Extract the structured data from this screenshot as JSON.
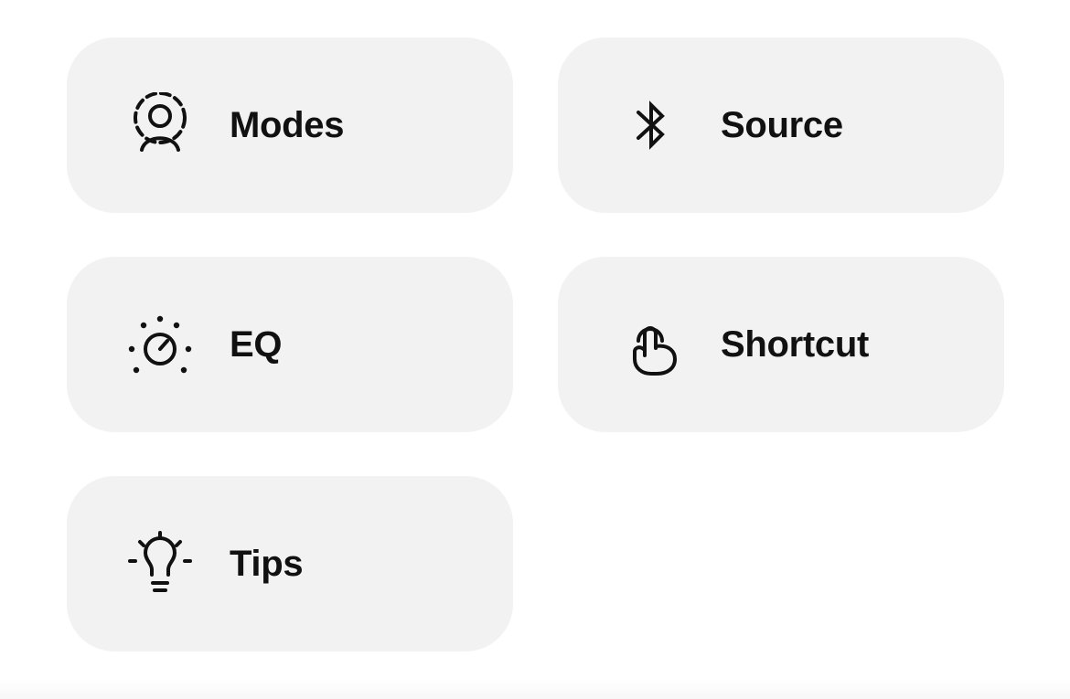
{
  "tiles": [
    {
      "label": "Modes",
      "icon": "modes-icon"
    },
    {
      "label": "Source",
      "icon": "bluetooth-icon"
    },
    {
      "label": "EQ",
      "icon": "eq-dial-icon"
    },
    {
      "label": "Shortcut",
      "icon": "touch-gesture-icon"
    },
    {
      "label": "Tips",
      "icon": "lightbulb-icon"
    }
  ],
  "colors": {
    "tile_background": "#f2f2f2",
    "text": "#111111",
    "page_background": "#ffffff"
  }
}
